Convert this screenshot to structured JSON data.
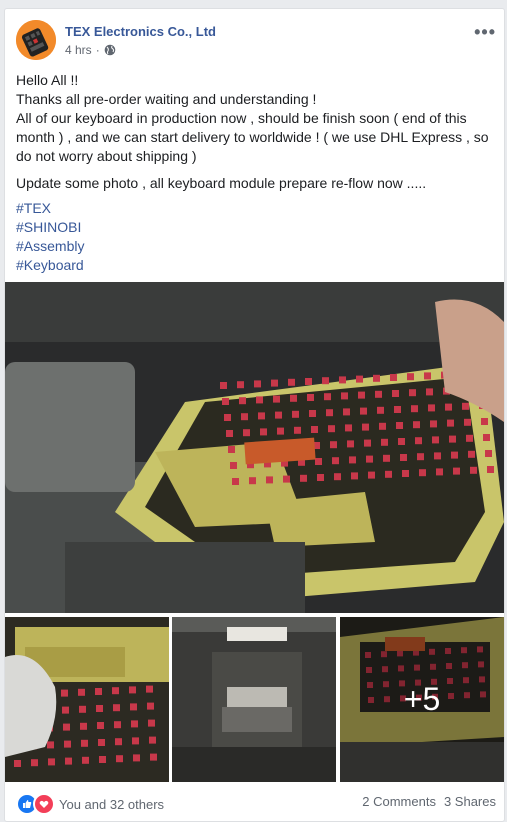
{
  "post": {
    "author": "TEX Electronics Co., Ltd",
    "time": "4 hrs",
    "privacy_icon": "globe-icon",
    "menu_icon": "more-options-icon",
    "paragraphs": [
      "Hello All !!",
      "Thanks all pre-order waiting and understanding !",
      "All of our keyboard in production now , should be finish soon ( end of this month ) , and we can start delivery to worldwide ! ( we use DHL Express , so do not worry about shipping )"
    ],
    "update_text": "Update some photo , all keyboard module prepare re-flow now .....",
    "hashtags": [
      "#TEX",
      "#SHINOBI",
      "#Assembly",
      "#Keyboard"
    ],
    "more_photos": "+5"
  },
  "footer": {
    "reactions_text": "You and 32 others",
    "comments": "2 Comments",
    "shares": "3 Shares"
  },
  "colors": {
    "link": "#385898",
    "like": "#1877f2",
    "love": "#f33e58"
  }
}
